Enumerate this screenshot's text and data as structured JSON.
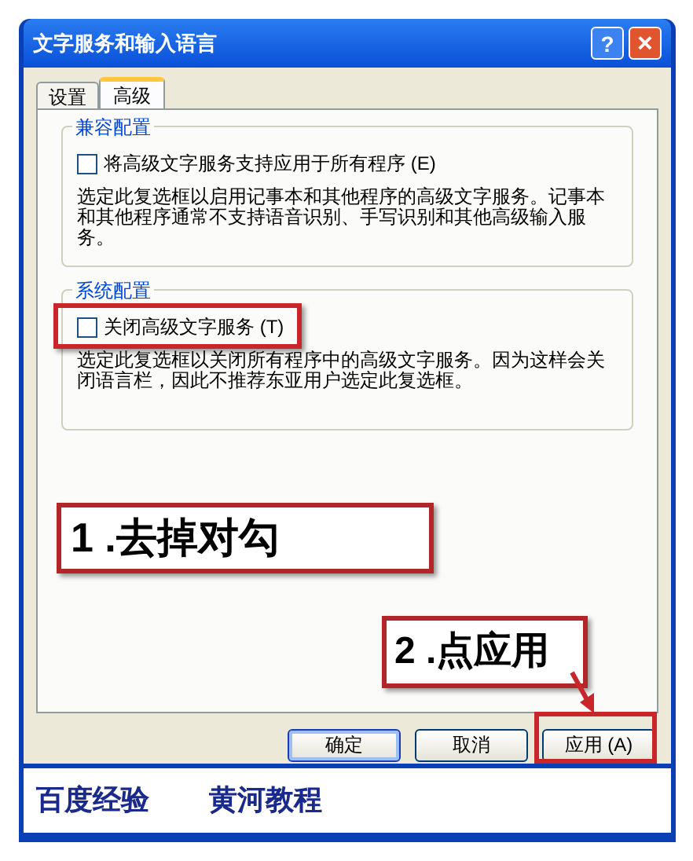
{
  "window": {
    "title": "文字服务和输入语言",
    "help": "?",
    "close": "×"
  },
  "tabs": [
    {
      "label": "设置",
      "selected": false
    },
    {
      "label": "高级",
      "selected": true
    }
  ],
  "groups": [
    {
      "title": "兼容配置",
      "checkbox": {
        "label": "将高级文字服务支持应用于所有程序 (E)",
        "checked": false,
        "highlighted": false
      },
      "description": "选定此复选框以启用记事本和其他程序的高级文字服务。记事本和其他程序通常不支持语音识别、手写识别和其他高级输入服务。"
    },
    {
      "title": "系统配置",
      "checkbox": {
        "label": "关闭高级文字服务 (T)",
        "checked": false,
        "highlighted": true
      },
      "description": "选定此复选框以关闭所有程序中的高级文字服务。因为这样会关闭语言栏，因此不推荐东亚用户选定此复选框。"
    }
  ],
  "buttons": [
    {
      "label": "确定",
      "default": true,
      "highlighted": false
    },
    {
      "label": "取消",
      "default": false,
      "highlighted": false
    },
    {
      "label": "应用 (A)",
      "default": false,
      "highlighted": true
    }
  ],
  "callouts": [
    "1 .去掉对勾",
    "2 .点应用"
  ],
  "caption": [
    "百度经验",
    "黄河教程"
  ]
}
